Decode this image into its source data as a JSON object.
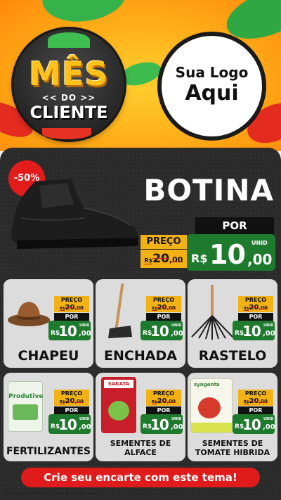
{
  "header": {
    "badge": {
      "line1": "MÊS",
      "line2": "<< DO >>",
      "line3": "CLIENTE"
    },
    "logo": {
      "line1": "Sua Logo",
      "line2": "Aqui"
    }
  },
  "featured": {
    "discount": "-50%",
    "title": "BOTINA",
    "preco_label": "PREÇO",
    "old_currency": "R$",
    "old_integer": "20",
    "old_cents": ",00",
    "por_label": "POR",
    "new_currency": "R$",
    "new_integer": "10",
    "new_cents": ",00",
    "unit": "UNID"
  },
  "products": [
    {
      "name": "CHAPEU",
      "preco_label": "PREÇO",
      "old_currency": "R$",
      "old_integer": "20",
      "old_cents": ",00",
      "por_label": "POR",
      "new_currency": "R$",
      "new_integer": "10",
      "new_cents": ",00",
      "unit": "UNID"
    },
    {
      "name": "ENCHADA",
      "preco_label": "PREÇO",
      "old_currency": "R$",
      "old_integer": "20",
      "old_cents": ",00",
      "por_label": "POR",
      "new_currency": "R$",
      "new_integer": "10",
      "new_cents": ",00",
      "unit": "UNID"
    },
    {
      "name": "RASTELO",
      "preco_label": "PREÇO",
      "old_currency": "R$",
      "old_integer": "20",
      "old_cents": ",00",
      "por_label": "POR",
      "new_currency": "R$",
      "new_integer": "10",
      "new_cents": ",00",
      "unit": "UNID"
    },
    {
      "name": "FERTILIZANTES",
      "pack_label": "Produtive",
      "preco_label": "PREÇO",
      "old_currency": "R$",
      "old_integer": "20",
      "old_cents": ",00",
      "por_label": "POR",
      "new_currency": "R$",
      "new_integer": "10",
      "new_cents": ",00",
      "unit": "UNID"
    },
    {
      "name_line1": "SEMENTES DE",
      "name_line2": "ALFACE",
      "pack_label": "SAKATA",
      "preco_label": "PREÇO",
      "old_currency": "R$",
      "old_integer": "20",
      "old_cents": ",00",
      "por_label": "POR",
      "new_currency": "R$",
      "new_integer": "10",
      "new_cents": ",00",
      "unit": "UNID"
    },
    {
      "name_line1": "SEMENTES DE",
      "name_line2": "TOMATE HIBRIDA",
      "pack_label": "syngenta",
      "preco_label": "PREÇO",
      "old_currency": "R$",
      "old_integer": "20",
      "old_cents": ",00",
      "por_label": "POR",
      "new_currency": "R$",
      "new_integer": "10",
      "new_cents": ",00",
      "unit": "UNID"
    }
  ],
  "footer": {
    "cta": "Crie seu encarte com este tema!",
    "disclaimer": "*Imagens Meramente Ilustrativas"
  },
  "colors": {
    "accent_yellow": "#f2b115",
    "price_green": "#1e7a2d",
    "cta_red": "#e01b1b",
    "panel": "#2b2b2b"
  }
}
